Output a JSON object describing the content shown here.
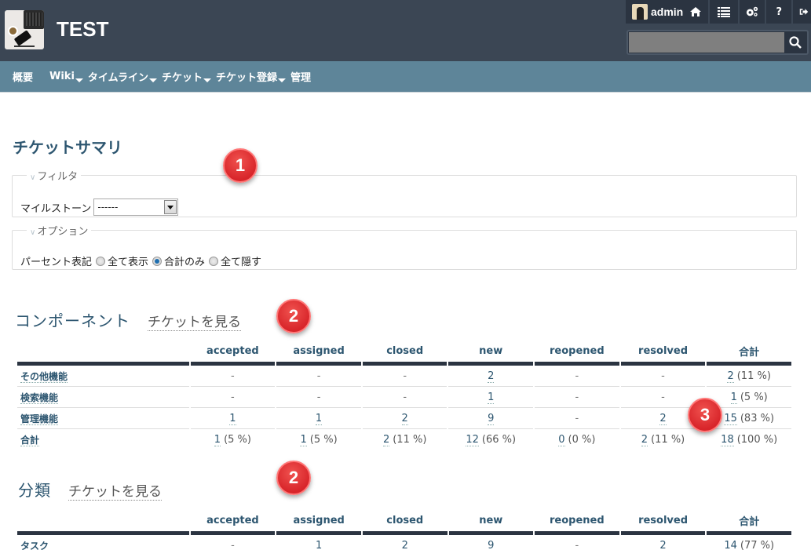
{
  "header": {
    "project_title": "TEST",
    "user": "admin",
    "icons": [
      "home-icon",
      "list-icon",
      "gears-icon",
      "help-icon",
      "logout-icon"
    ],
    "help_label": "?",
    "search_placeholder": ""
  },
  "mainnav": {
    "items": [
      {
        "label": "概要",
        "dropdown": false
      },
      {
        "label": "Wiki",
        "dropdown": true
      },
      {
        "label": "タイムライン",
        "dropdown": true
      },
      {
        "label": "チケット",
        "dropdown": true
      },
      {
        "label": "チケット登録",
        "dropdown": true
      },
      {
        "label": "管理",
        "dropdown": false
      }
    ]
  },
  "page_title": "チケットサマリ",
  "filter": {
    "legend": "フィルタ",
    "milestone_label": "マイルストーン",
    "milestone_value": "------"
  },
  "options": {
    "legend": "オプション",
    "percent_label": "パーセント表記",
    "radios": [
      {
        "label": "全て表示",
        "checked": false
      },
      {
        "label": "合計のみ",
        "checked": true
      },
      {
        "label": "全て隠す",
        "checked": false
      }
    ]
  },
  "badges": [
    "1",
    "2",
    "3",
    "2"
  ],
  "columns": [
    "accepted",
    "assigned",
    "closed",
    "new",
    "reopened",
    "resolved",
    "合計"
  ],
  "component": {
    "title": "コンポーネント",
    "link": "チケットを見る",
    "rows": [
      {
        "name": "その他機能",
        "cells": [
          "-",
          "-",
          "-",
          "2",
          "-",
          "-",
          "2"
        ],
        "pct": [
          "",
          "",
          "",
          "",
          "",
          "",
          "(11 %)"
        ]
      },
      {
        "name": "検索機能",
        "cells": [
          "-",
          "-",
          "-",
          "1",
          "-",
          "-",
          "1"
        ],
        "pct": [
          "",
          "",
          "",
          "",
          "",
          "",
          "(5 %)"
        ]
      },
      {
        "name": "管理機能",
        "cells": [
          "1",
          "1",
          "2",
          "9",
          "-",
          "2",
          "15"
        ],
        "pct": [
          "",
          "",
          "",
          "",
          "",
          "",
          "(83 %)"
        ]
      },
      {
        "name": "合計",
        "cells": [
          "1",
          "1",
          "2",
          "12",
          "0",
          "2",
          "18"
        ],
        "pct": [
          "(5 %)",
          "(5 %)",
          "(11 %)",
          "(66 %)",
          "(0 %)",
          "(11 %)",
          "(100 %)"
        ]
      }
    ]
  },
  "category": {
    "title": "分類",
    "link": "チケットを見る",
    "rows": [
      {
        "name": "タスク",
        "cells": [
          "-",
          "1",
          "2",
          "9",
          "-",
          "2",
          "14"
        ],
        "pct": [
          "",
          "",
          "",
          "",
          "",
          "",
          "(77 %)"
        ]
      }
    ]
  }
}
